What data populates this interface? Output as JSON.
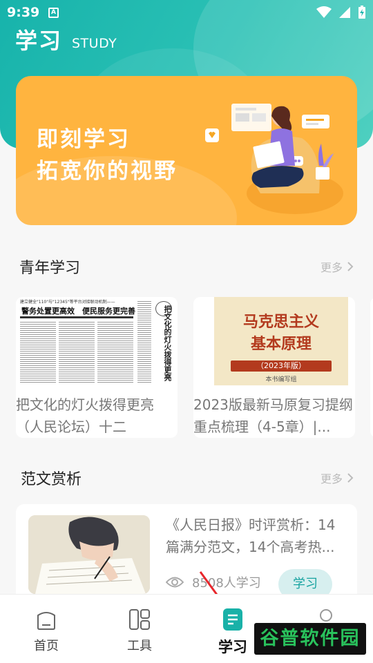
{
  "status_bar": {
    "time": "9:39",
    "a_icon": "A"
  },
  "header": {
    "title": "学习",
    "subtitle": "STUDY"
  },
  "banner": {
    "line1": "即刻学习",
    "line2": "拓宽你的视野"
  },
  "youth_section": {
    "title": "青年学习",
    "more_label": "更多",
    "cards": [
      {
        "thumb": {
          "headline_small": "建立健全\"110\"与\"12345\"等平台对接联动机制——",
          "headline": "警务处置更高效　便民服务更完善",
          "vertical_title": "把文化的灯火拨得更亮"
        },
        "text": "把文化的灯火拨得更亮（人民论坛）十二"
      },
      {
        "thumb": {
          "title_line1": "马克思主义",
          "title_line2": "基本原理",
          "edition": "（2023年版）",
          "publisher": "本书编写组"
        },
        "text": "2023版最新马原复习提纲重点梳理（4-5章）|..."
      }
    ]
  },
  "essay_section": {
    "title": "范文赏析",
    "more_label": "更多",
    "article": {
      "title": "《人民日报》时评赏析：14篇满分范文，14个高考热...",
      "views": "8508人学习",
      "button": "学习"
    }
  },
  "tabbar": {
    "items": [
      {
        "label": "首页",
        "icon": "home-icon"
      },
      {
        "label": "工具",
        "icon": "tools-icon"
      },
      {
        "label": "学习",
        "icon": "study-icon",
        "active": true
      },
      {
        "label": "",
        "icon": "profile-icon"
      }
    ]
  },
  "watermark": "谷普软件园",
  "colors": {
    "teal": "#17b3ab",
    "banner_orange": "#ffb43f",
    "button_bg": "#d7efef",
    "button_text": "#17a3a0"
  }
}
